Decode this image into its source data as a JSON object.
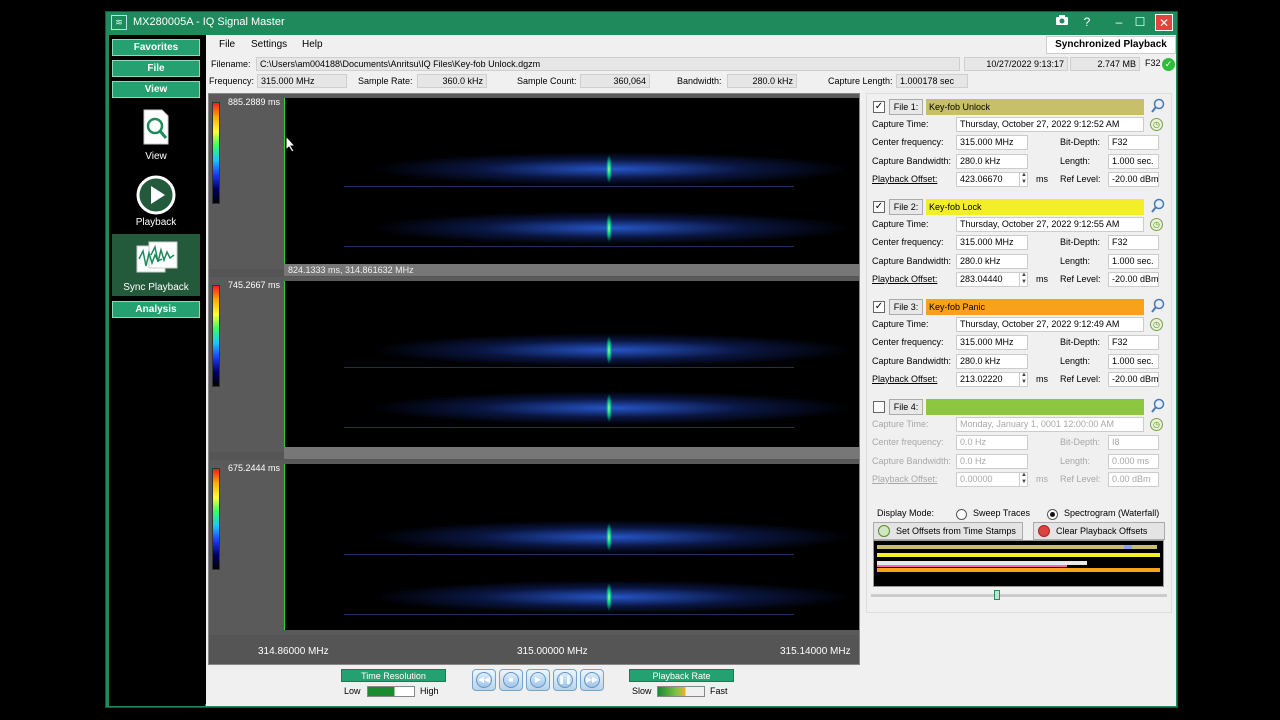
{
  "window": {
    "title": "MX280005A - IQ Signal Master",
    "app_icon": "app-logo-icon"
  },
  "titlebar_icons": [
    "camera-icon",
    "help-icon",
    "minimize-icon",
    "maximize-icon",
    "close-icon"
  ],
  "nav": {
    "favorites": "Favorites",
    "file": "File",
    "view": "View",
    "analysis": "Analysis",
    "tiles": [
      {
        "label": "View",
        "icon": "document-magnify-icon"
      },
      {
        "label": "Playback",
        "icon": "play-circle-icon"
      },
      {
        "label": "Sync Playback",
        "icon": "sync-waveform-icon"
      }
    ]
  },
  "menu": {
    "file": "File",
    "settings": "Settings",
    "help": "Help",
    "mode": "Synchronized Playback"
  },
  "info": {
    "filename_label": "Filename:",
    "filename": "C:\\Users\\am004188\\Documents\\Anritsu\\IQ Files\\Key-fob Unlock.dgzm",
    "datetime": "10/27/2022 9:13:17",
    "filesize": "2.747 MB",
    "format": "F32",
    "frequency_label": "Frequency:",
    "frequency": "315.000 MHz",
    "sample_rate_label": "Sample Rate:",
    "sample_rate": "360.0 kHz",
    "sample_count_label": "Sample Count:",
    "sample_count": "360,064",
    "bandwidth_label": "Bandwidth:",
    "bandwidth": "280.0 kHz",
    "capture_length_label": "Capture Length:",
    "capture_length": "1.000178 sec"
  },
  "spectrogram": {
    "panels": [
      {
        "time": "885.2889 ms",
        "status": "824.1333 ms, 314.861632 MHz"
      },
      {
        "time": "745.2667 ms",
        "status": ""
      },
      {
        "time": "675.2444 ms",
        "status": ""
      }
    ],
    "freq_left": "314.86000 MHz",
    "freq_center": "315.00000 MHz",
    "freq_right": "315.14000 MHz"
  },
  "files_labels": {
    "capture_time": "Capture Time:",
    "center_frequency": "Center frequency:",
    "capture_bandwidth": "Capture Bandwidth:",
    "playback_offset": "Playback Offset:",
    "bit_depth": "Bit-Depth:",
    "length": "Length:",
    "ref_level": "Ref Level:",
    "ms": "ms"
  },
  "files": [
    {
      "checked": true,
      "button": "File 1:",
      "name": "Key-fob Unlock",
      "color": "#c8bf6a",
      "capture_time": "Thursday, October 27, 2022 9:12:52 AM",
      "center_frequency": "315.000 MHz",
      "capture_bandwidth": "280.0 kHz",
      "playback_offset": "423.06670",
      "bit_depth": "F32",
      "length": "1.000 sec.",
      "ref_level": "-20.00 dBm"
    },
    {
      "checked": true,
      "button": "File 2:",
      "name": "Key-fob Lock",
      "color": "#f2ee2a",
      "capture_time": "Thursday, October 27, 2022 9:12:55 AM",
      "center_frequency": "315.000 MHz",
      "capture_bandwidth": "280.0 kHz",
      "playback_offset": "283.04440",
      "bit_depth": "F32",
      "length": "1.000 sec.",
      "ref_level": "-20.00 dBm"
    },
    {
      "checked": true,
      "button": "File 3:",
      "name": "Key-fob Panic",
      "color": "#f7a21a",
      "capture_time": "Thursday, October 27, 2022 9:12:49 AM",
      "center_frequency": "315.000 MHz",
      "capture_bandwidth": "280.0 kHz",
      "playback_offset": "213.02220",
      "bit_depth": "F32",
      "length": "1.000 sec.",
      "ref_level": "-20.00 dBm"
    },
    {
      "checked": false,
      "button": "File 4:",
      "name": "",
      "color": "#8dc63f",
      "capture_time": "Monday, January 1, 0001 12:00:00 AM",
      "center_frequency": "0.0 Hz",
      "capture_bandwidth": "0.0 Hz",
      "playback_offset": "0.00000",
      "bit_depth": "I8",
      "length": "0.000 ms",
      "ref_level": "0.00 dBm"
    }
  ],
  "display_mode": {
    "label": "Display Mode:",
    "sweep": "Sweep Traces",
    "spectrogram": "Spectrogram (Waterfall)",
    "selected": "spectrogram"
  },
  "buttons": {
    "set_offsets": "Set Offsets from Time Stamps",
    "clear_offsets": "Clear Playback Offsets"
  },
  "controls": {
    "time_resolution": "Time Resolution",
    "low": "Low",
    "high": "High",
    "playback_rate": "Playback Rate",
    "slow": "Slow",
    "fast": "Fast",
    "transport_icons": [
      "rewind-icon",
      "stop-icon",
      "play-icon",
      "pause-icon",
      "fast-forward-icon"
    ]
  }
}
